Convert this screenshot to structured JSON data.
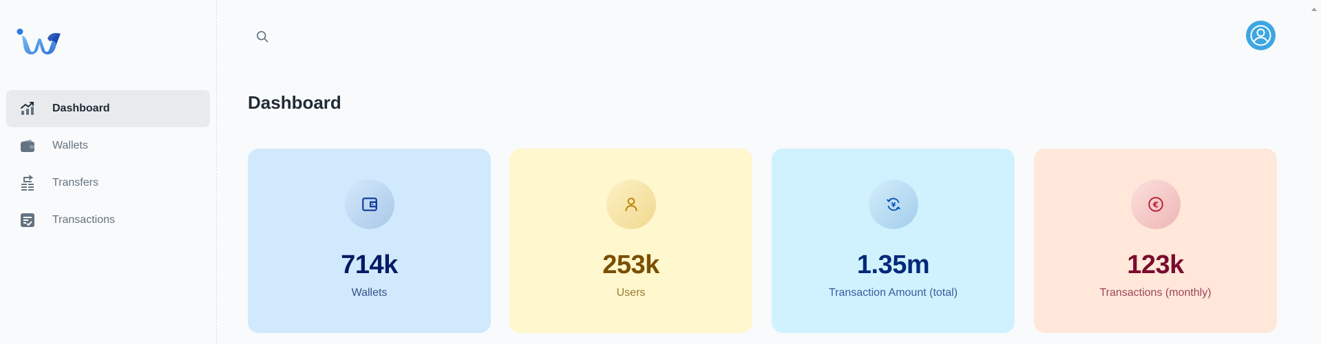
{
  "sidebar": {
    "items": [
      {
        "label": "Dashboard",
        "icon": "chart-icon",
        "active": true
      },
      {
        "label": "Wallets",
        "icon": "wallet-icon",
        "active": false
      },
      {
        "label": "Transfers",
        "icon": "transfer-icon",
        "active": false
      },
      {
        "label": "Transactions",
        "icon": "receipt-icon",
        "active": false
      }
    ]
  },
  "header": {
    "search_icon": "search-icon",
    "avatar_icon": "user-icon"
  },
  "main": {
    "title": "Dashboard",
    "cards": [
      {
        "value": "714k",
        "label": "Wallets",
        "icon": "wallet-icon",
        "bg": "#d1e9fc",
        "color": "#061b64",
        "icon_bg": "#b8d3ee"
      },
      {
        "value": "253k",
        "label": "Users",
        "icon": "user-icon",
        "bg": "#fff7cd",
        "color": "#7a4f01",
        "icon_bg": "#f5e3a6"
      },
      {
        "value": "1.35m",
        "label": "Transaction Amount (total)",
        "icon": "currency-exchange-icon",
        "bg": "#d0f2ff",
        "color": "#04297a",
        "icon_bg": "#b3dcf4"
      },
      {
        "value": "123k",
        "label": "Transactions (monthly)",
        "icon": "euro-icon",
        "bg": "#ffe7d9",
        "color": "#7a0c2e",
        "icon_bg": "#f5c8c4"
      }
    ]
  },
  "colors": {
    "avatar": "#3ea6e2",
    "active_nav_bg": "#e8eaec",
    "logo_dark": "#1a56c5",
    "logo_light": "#5ba4ee"
  }
}
